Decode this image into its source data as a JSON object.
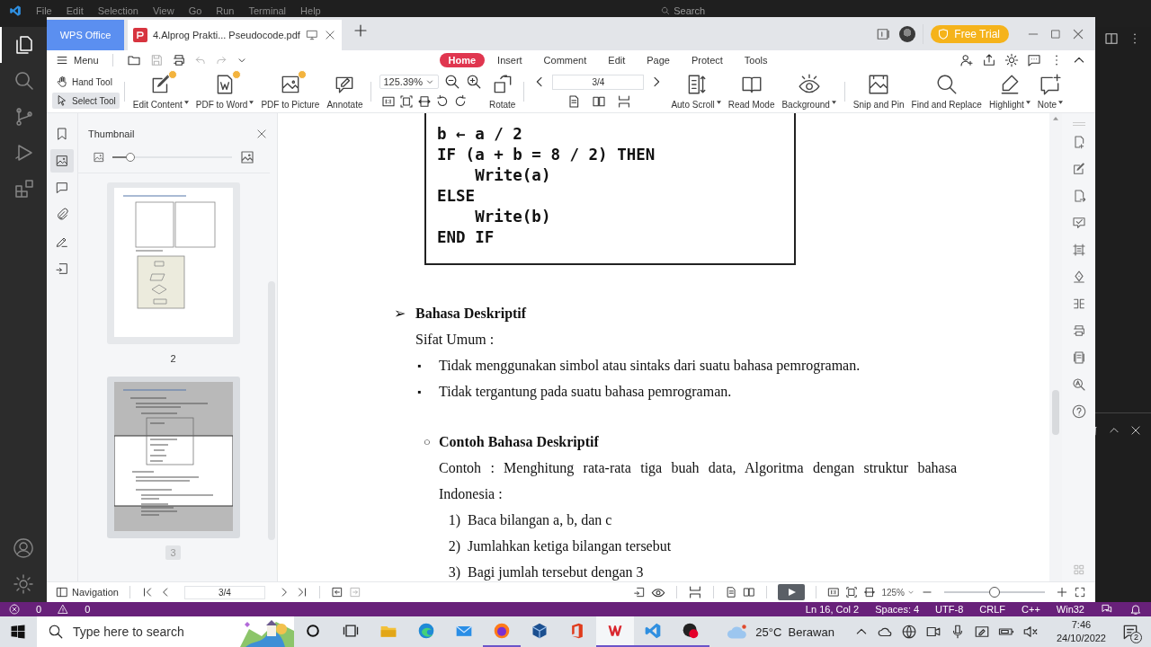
{
  "vscode": {
    "menu": [
      "File",
      "Edit",
      "Selection",
      "View",
      "Go",
      "Run",
      "Terminal",
      "Help"
    ],
    "search": {
      "placeholder": "Search"
    },
    "activity": [
      {
        "selected": true
      },
      {
        "selected": false
      },
      {
        "selected": false
      },
      {
        "selected": false
      },
      {
        "selected": false
      }
    ],
    "status_bar": {
      "errors": "0",
      "warnings": "0",
      "items": [
        "Ln 16, Col 2",
        "Spaces: 4",
        "UTF-8",
        "CRLF",
        "C++",
        "Win32"
      ]
    }
  },
  "wps": {
    "tabs": [
      {
        "kind": "home",
        "label": "WPS Office",
        "selected": false
      },
      {
        "kind": "document",
        "label": "4.Alprog Prakti... Pseudocode.pdf",
        "selected": true
      }
    ],
    "free_trial": "Free Trial",
    "menu": "Menu",
    "ribbon_tabs": [
      {
        "label": "Home",
        "selected": true
      },
      {
        "label": "Insert",
        "selected": false
      },
      {
        "label": "Comment",
        "selected": false
      },
      {
        "label": "Edit",
        "selected": false
      },
      {
        "label": "Page",
        "selected": false
      },
      {
        "label": "Protect",
        "selected": false
      },
      {
        "label": "Tools",
        "selected": false
      }
    ],
    "tools": [
      {
        "label": "Hand Tool",
        "selected": false
      },
      {
        "label": "Select Tool",
        "selected": true
      }
    ],
    "convert_buttons": [
      {
        "label": "Edit Content",
        "dropdown": true,
        "premium": true
      },
      {
        "label": "PDF to Word",
        "dropdown": true,
        "premium": true
      },
      {
        "label": "PDF to Picture",
        "dropdown": false,
        "premium": true
      },
      {
        "label": "Annotate",
        "dropdown": false,
        "premium": false
      }
    ],
    "zoom": "125.39%",
    "rotate": "Rotate",
    "page": "3/4",
    "view_buttons": [
      {
        "label": "Auto Scroll",
        "dropdown": true
      },
      {
        "label": "Read Mode",
        "dropdown": false
      },
      {
        "label": "Background",
        "dropdown": true
      },
      {
        "label": "Snip and Pin",
        "dropdown": false
      },
      {
        "label": "Find and Replace",
        "dropdown": false
      },
      {
        "label": "Highlight",
        "dropdown": true
      },
      {
        "label": "Note",
        "dropdown": true
      }
    ],
    "sidebar": [
      {
        "selected": false
      },
      {
        "selected": true
      },
      {
        "selected": false
      },
      {
        "selected": false
      },
      {
        "selected": false
      },
      {
        "selected": false
      }
    ],
    "thumbnail": {
      "title": "Thumbnail",
      "size": {
        "level": 0.15
      },
      "pages": [
        {
          "label": "2",
          "selected": false
        },
        {
          "label": "3",
          "selected": true
        }
      ]
    },
    "document": {
      "code": [
        "b ← a / 2",
        "IF (a + b = 8 / 2) THEN",
        "    Write(a)",
        "ELSE",
        "    Write(b)",
        "END IF"
      ],
      "section": {
        "bullet": "➢",
        "title": "Bahasa Deskriptif"
      },
      "subtitle": "Sifat Umum :",
      "bullets": [
        {
          "marker": "▪",
          "text": "Tidak menggunakan simbol atau sintaks dari suatu bahasa pemrograman."
        },
        {
          "marker": "▪",
          "text": "Tidak tergantung pada suatu bahasa pemrograman."
        }
      ],
      "example": {
        "bullet": "○",
        "title": "Contoh Bahasa Deskriptif",
        "paragraph": "Contoh : Menghitung rata-rata tiga buah data, Algoritma dengan struktur bahasa Indonesia :",
        "steps": [
          {
            "number": "1)",
            "text": "Baca bilangan a, b, dan c"
          },
          {
            "number": "2)",
            "text": "Jumlahkan ketiga bilangan tersebut"
          },
          {
            "number": "3)",
            "text": "Bagi jumlah tersebut dengan 3"
          }
        ]
      }
    },
    "navigation": {
      "label": "Navigation",
      "page": "3/4",
      "zoom": "125%",
      "zoom_slider": {
        "level": 0.5
      }
    }
  },
  "taskbar": {
    "search": {
      "placeholder": "Type here to search"
    },
    "apps": [
      {
        "running": false,
        "active": false
      },
      {
        "running": false,
        "active": false
      },
      {
        "running": false,
        "active": false
      },
      {
        "running": false,
        "active": false
      },
      {
        "running": false,
        "active": false
      },
      {
        "running": true,
        "active": false
      },
      {
        "running": false,
        "active": false
      },
      {
        "running": false,
        "active": false
      },
      {
        "running": true,
        "active": true
      },
      {
        "running": true,
        "active": false
      }
    ],
    "weather": "25°C  Berawan",
    "time": "7:46",
    "date": "24/10/2022",
    "notifications": "2"
  }
}
